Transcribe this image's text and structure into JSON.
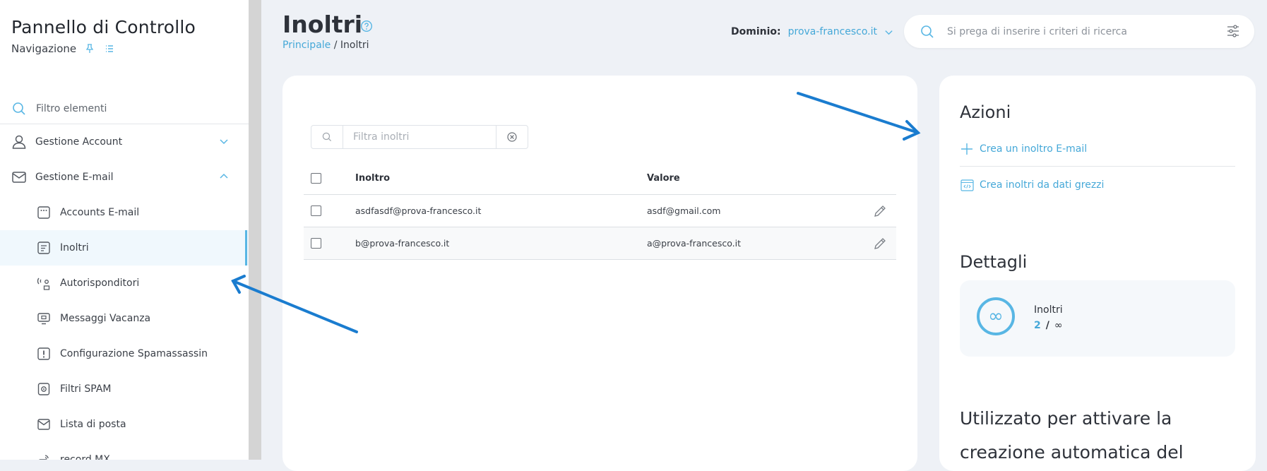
{
  "sidebar": {
    "title": "Pannello di Controllo",
    "subtitle": "Navigazione",
    "filter_placeholder": "Filtro elementi",
    "items": [
      {
        "label": "Gestione Account",
        "icon": "user-icon"
      },
      {
        "label": "Gestione E-mail",
        "icon": "envelope-icon"
      },
      {
        "label": "Accounts E-mail",
        "icon": "dots-window-icon"
      },
      {
        "label": "Inoltri",
        "icon": "forward-doc-icon"
      },
      {
        "label": "Autorisponditori",
        "icon": "signal-person-icon"
      },
      {
        "label": "Messaggi Vacanza",
        "icon": "monitor-icon"
      },
      {
        "label": "Configurazione Spamassassin",
        "icon": "exclamation-box-icon"
      },
      {
        "label": "Filtri SPAM",
        "icon": "shield-box-icon"
      },
      {
        "label": "Lista di posta",
        "icon": "mail-list-icon"
      },
      {
        "label": "record MX",
        "icon": "signal-icon"
      }
    ]
  },
  "header": {
    "title": "Inoltri",
    "breadcrumb_home": "Principale",
    "breadcrumb_sep": " / ",
    "breadcrumb_current": "Inoltri",
    "domain_label": "Dominio:",
    "domain_value": "prova-francesco.it",
    "search_placeholder": "Si prega di inserire i criteri di ricerca"
  },
  "table": {
    "filter_placeholder": "Filtra inoltri",
    "columns": {
      "forward": "Inoltro",
      "value": "Valore"
    },
    "rows": [
      {
        "forward": "asdfasdf@prova-francesco.it",
        "value": "asdf@gmail.com"
      },
      {
        "forward": "b@prova-francesco.it",
        "value": "a@prova-francesco.it"
      }
    ]
  },
  "actions": {
    "title": "Azioni",
    "items": [
      {
        "label": "Crea un inoltro E-mail",
        "icon": "plus-icon"
      },
      {
        "label": "Crea inoltri da dati grezzi",
        "icon": "code-window-icon"
      }
    ]
  },
  "details": {
    "title": "Dettagli",
    "name": "Inoltri",
    "used": "2",
    "separator": "/",
    "max": "∞",
    "ring_symbol": "∞"
  },
  "description": "Utilizzato per attivare la creazione automatica del",
  "colors": {
    "accent": "#45a8d8",
    "active_bar": "#58b6e4",
    "annotation_arrow": "#1a7ccf",
    "background": "#eef1f6"
  }
}
